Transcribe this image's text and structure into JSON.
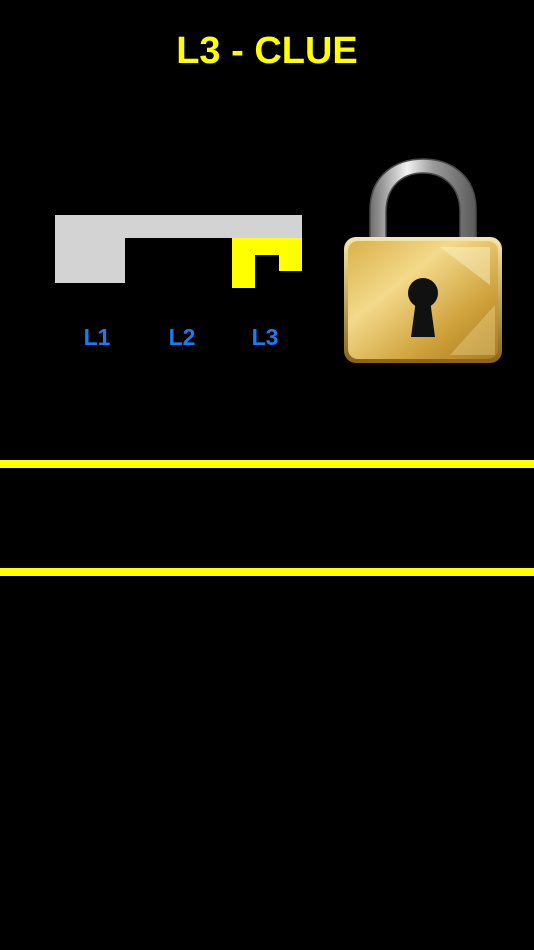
{
  "header": {
    "title": "L3 - CLUE"
  },
  "key": {
    "levels": [
      {
        "label": "L1",
        "state": "unlocked"
      },
      {
        "label": "L2",
        "state": "unlocked"
      },
      {
        "label": "L3",
        "state": "current"
      }
    ]
  },
  "lock": {
    "icon": "padlock-icon",
    "state": "locked"
  },
  "colors": {
    "background": "#000000",
    "title": "#FFFF00",
    "key_body": "#D3D3D3",
    "key_current_notch": "#FFFF00",
    "level_label": "#1E7BEF",
    "divider": "#FFFF00"
  }
}
